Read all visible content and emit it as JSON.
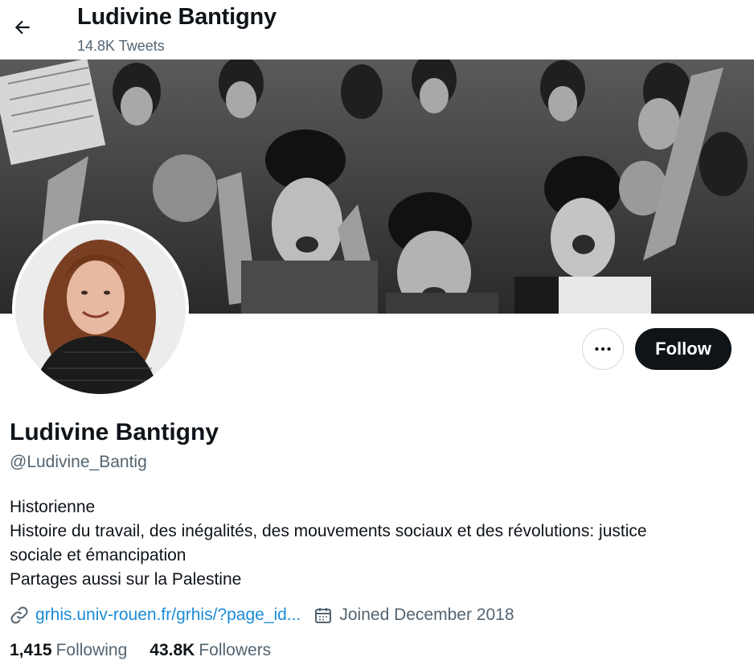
{
  "header": {
    "title": "Ludivine Bantigny",
    "tweet_count": "14.8K Tweets"
  },
  "profile": {
    "display_name": "Ludivine Bantigny",
    "handle": "@Ludivine_Bantig",
    "bio_lines": [
      "Historienne",
      "Histoire du travail, des inégalités, des mouvements sociaux et des révolutions: justice",
      "sociale et émancipation",
      "Partages aussi sur la Palestine"
    ],
    "website": "grhis.univ-rouen.fr/grhis/?page_id...",
    "joined": "Joined December 2018",
    "following_count": "1,415",
    "following_label": "Following",
    "followers_count": "43.8K",
    "followers_label": "Followers"
  },
  "actions": {
    "follow_label": "Follow"
  },
  "icons": {
    "back": "arrow-left-icon",
    "more": "more-horizontal-icon",
    "link": "link-icon",
    "calendar": "calendar-icon"
  },
  "colors": {
    "text_primary": "#0f1419",
    "text_secondary": "#536471",
    "link": "#1a8cd8",
    "button_dark": "#0f1419"
  }
}
